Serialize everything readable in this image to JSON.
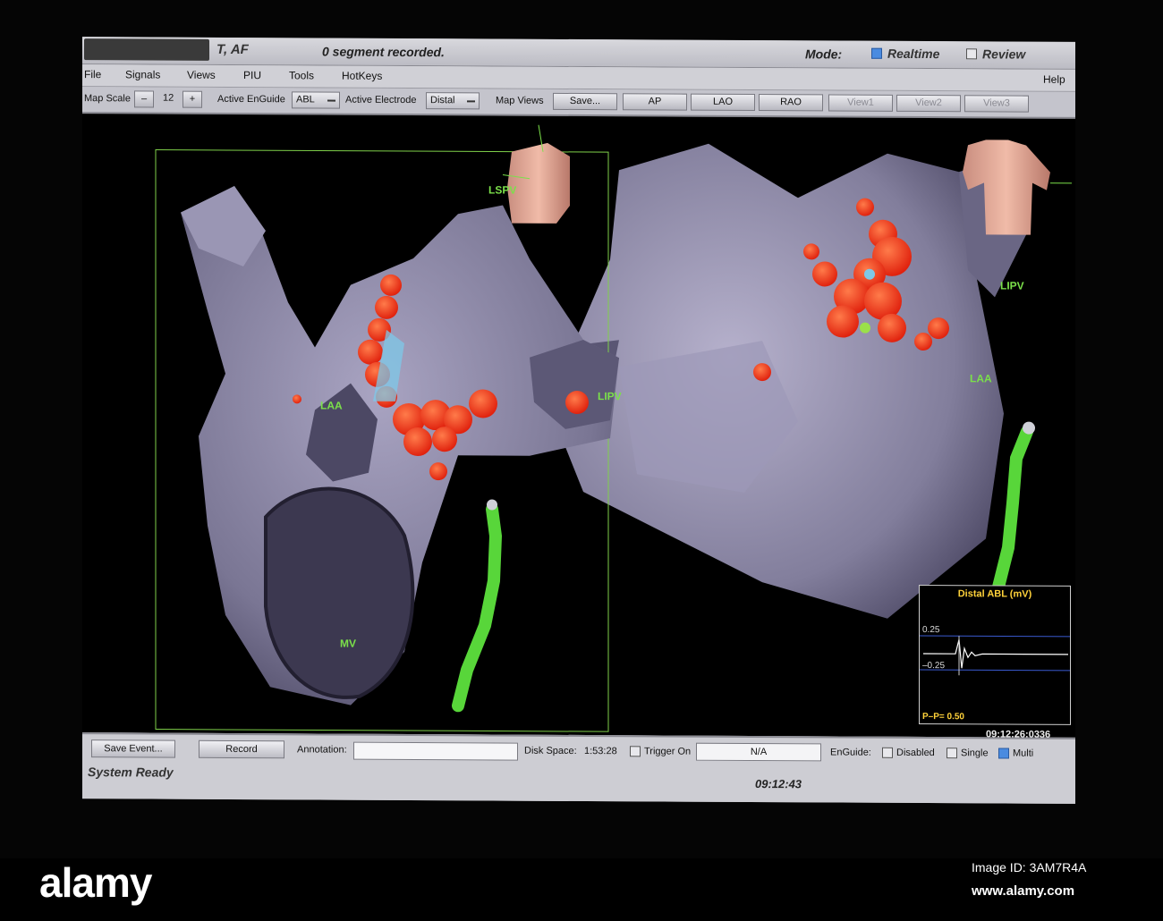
{
  "window": {
    "title_fragment": "T, AF",
    "segment_status": "0 segment recorded.",
    "mode_label": "Mode:",
    "mode_options": [
      {
        "label": "Realtime",
        "checked": true
      },
      {
        "label": "Review",
        "checked": false
      }
    ]
  },
  "menu": [
    "File",
    "Signals",
    "Views",
    "PIU",
    "Tools",
    "HotKeys",
    "Help"
  ],
  "toolbar": {
    "map_scale_label": "Map Scale",
    "map_scale_minus": "–",
    "map_scale_value": "12",
    "map_scale_plus": "+",
    "active_enguide_label": "Active EnGuide",
    "active_enguide_value": "ABL",
    "active_electrode_label": "Active Electrode",
    "active_electrode_value": "Distal",
    "map_views_label": "Map Views",
    "buttons": [
      "Save...",
      "AP",
      "LAO",
      "RAO",
      "View1",
      "View2",
      "View3"
    ]
  },
  "viewport": {
    "left_labels": {
      "lspv": "LSPV",
      "laa": "LAA",
      "lipv": "LIPV",
      "mv": "MV"
    },
    "right_labels": {
      "lipv": "LIPV",
      "laa": "LAA"
    }
  },
  "signal_panel": {
    "title": "Distal ABL (mV)",
    "upper_value": "0.25",
    "lower_value": "–0.25",
    "pp": "P–P= 0.50",
    "timestamp": "09:12:26:0336"
  },
  "statusbar": {
    "save_event": "Save Event...",
    "record": "Record",
    "annotation_label": "Annotation:",
    "annotation_value": "",
    "disk_space_label": "Disk Space:",
    "disk_space_value": "1:53:28",
    "trigger_label": "Trigger On",
    "trigger_checked": false,
    "na_button": "N/A",
    "enguide_label": "EnGuide:",
    "enguide_options": [
      {
        "label": "Disabled",
        "checked": false
      },
      {
        "label": "Single",
        "checked": false
      },
      {
        "label": "Multi",
        "checked": true
      }
    ],
    "system_status": "System Ready",
    "clock": "09:12:43"
  },
  "photo_credit": {
    "brand": "alamy",
    "image_id": "Image ID: 3AM7R4A",
    "url": "www.alamy.com"
  },
  "colors": {
    "accent_green": "#7be04a",
    "lesion_red": "#ff3b1f",
    "chamber": "#8f8aa8",
    "catheter": "#58d63a"
  }
}
